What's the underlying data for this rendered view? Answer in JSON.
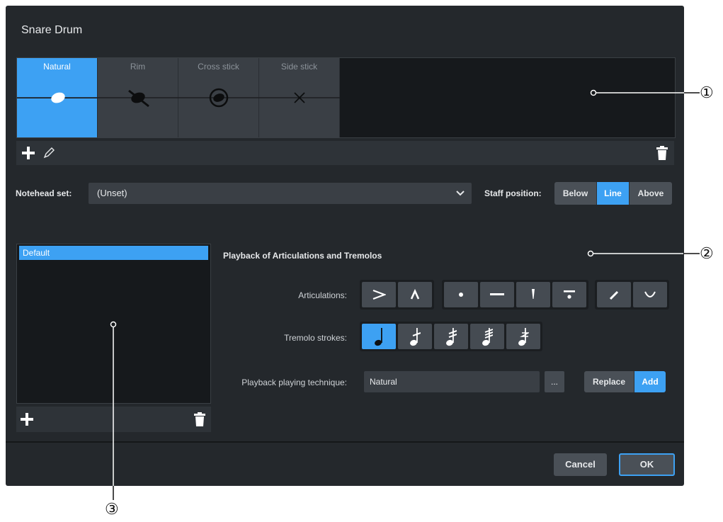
{
  "dialog": {
    "title": "Snare Drum"
  },
  "techniques": [
    {
      "label": "Natural",
      "icon": "natural-notehead-icon",
      "selected": true
    },
    {
      "label": "Rim",
      "icon": "rim-notehead-icon",
      "selected": false
    },
    {
      "label": "Cross stick",
      "icon": "cross-stick-notehead-icon",
      "selected": false
    },
    {
      "label": "Side stick",
      "icon": "side-stick-notehead-icon",
      "selected": false
    }
  ],
  "notehead": {
    "label": "Notehead set:",
    "value": "(Unset)"
  },
  "staff_position": {
    "label": "Staff position:",
    "options": [
      "Below",
      "Line",
      "Above"
    ],
    "selected": "Line"
  },
  "variations": {
    "items": [
      "Default"
    ]
  },
  "playback": {
    "title": "Playback of Articulations and Tremolos",
    "articulations_label": "Articulations:",
    "tremolo_label": "Tremolo strokes:",
    "technique_label": "Playback playing technique:",
    "technique_value": "Natural",
    "ellipsis": "...",
    "mode_options": [
      "Replace",
      "Add"
    ],
    "mode_selected": "Add"
  },
  "footer": {
    "cancel": "Cancel",
    "ok": "OK"
  },
  "callouts": [
    "①",
    "②",
    "③"
  ],
  "colors": {
    "accent": "#3da1f3",
    "dialog_bg": "#24282c",
    "panel_bg": "#16191c"
  }
}
